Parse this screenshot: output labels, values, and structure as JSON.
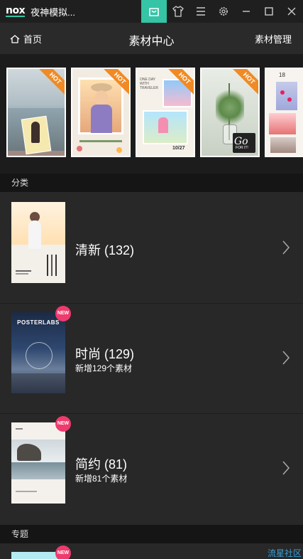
{
  "titlebar": {
    "logo": "nox",
    "title": "夜神模拟...",
    "icons": [
      "shopping-bag-icon",
      "shirt-icon",
      "menu-icon",
      "settings-icon",
      "minimize-icon",
      "maximize-icon",
      "close-icon"
    ],
    "accent_color": "#35c4a5"
  },
  "header": {
    "home_label": "首页",
    "title": "素材中心",
    "manage_label": "素材管理"
  },
  "carousel": {
    "items": [
      {
        "badge": "HOT"
      },
      {
        "badge": "HOT"
      },
      {
        "badge": "HOT",
        "caption_lines": [
          "ONE DAY",
          "WITH",
          "TRAVELER"
        ],
        "date": "10/27"
      },
      {
        "badge": "HOT",
        "caption_lines": [
          "Go",
          "FOR IT!"
        ]
      },
      {
        "badge": "",
        "caption_lines": [
          "18"
        ]
      }
    ]
  },
  "categories": {
    "label": "分类",
    "items": [
      {
        "title": "清新 (132)",
        "subtitle": "",
        "is_new": false
      },
      {
        "title": "时尚 (129)",
        "subtitle": "新增129个素材",
        "is_new": true,
        "thumb_text": "POSTERLABS"
      },
      {
        "title": "简约 (81)",
        "subtitle": "新增81个素材",
        "is_new": true
      }
    ],
    "new_badge": "NEW"
  },
  "topics": {
    "label": "专题",
    "new_badge": "NEW"
  },
  "watermark": "流星社区"
}
